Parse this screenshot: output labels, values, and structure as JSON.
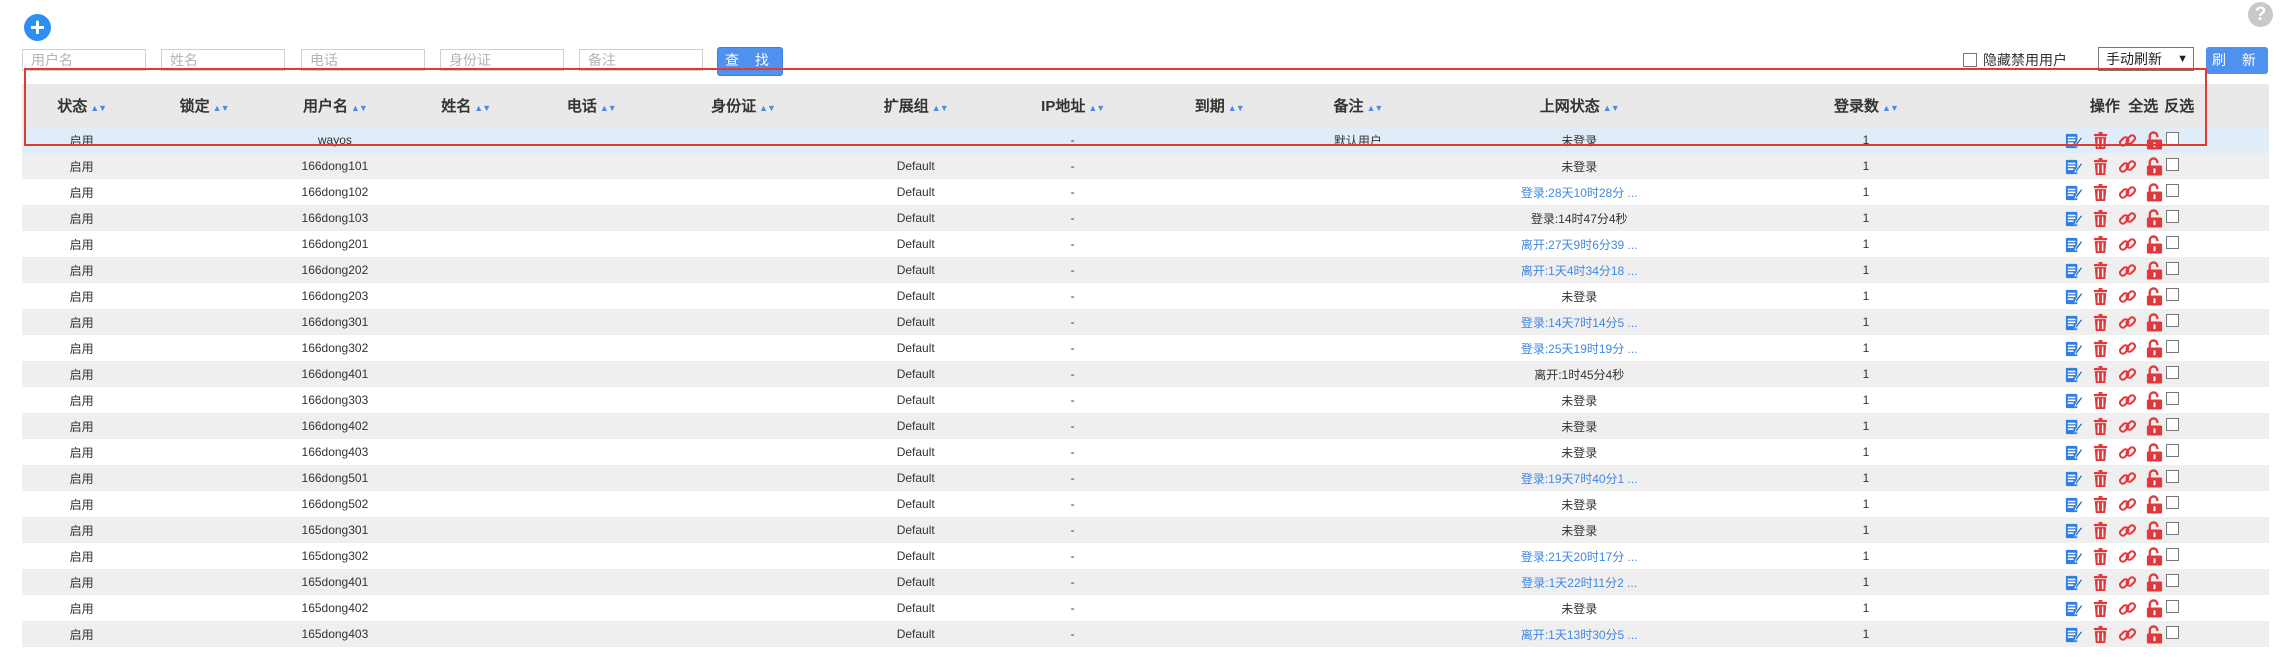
{
  "toolbar": {
    "add_symbol": "+",
    "help_symbol": "?",
    "filters": [
      {
        "placeholder": "用户名"
      },
      {
        "placeholder": "姓名"
      },
      {
        "placeholder": "电话"
      },
      {
        "placeholder": "身份证"
      },
      {
        "placeholder": "备注"
      }
    ],
    "search_label": "查 找",
    "hide_disabled_label": "隐藏禁用用户",
    "refresh_mode": "手动刷新",
    "refresh_label": "刷 新"
  },
  "table": {
    "headers": {
      "status": "状态",
      "lock": "锁定",
      "username": "用户名",
      "name": "姓名",
      "phone": "电话",
      "id_card": "身份证",
      "group": "扩展组",
      "ip": "IP地址",
      "expire": "到期",
      "note": "备注",
      "online": "上网状态",
      "logins": "登录数",
      "ops": "操作",
      "select_all": "全选",
      "invert": "反选"
    },
    "rows": [
      {
        "status": "启用",
        "lock": "",
        "username": "wayos",
        "name": "",
        "phone": "",
        "id_card": "",
        "group": "",
        "ip": "-",
        "expire": "",
        "note": "默认用户",
        "online": "未登录",
        "logins": "1",
        "online_link": false
      },
      {
        "status": "启用",
        "lock": "",
        "username": "166dong101",
        "name": "",
        "phone": "",
        "id_card": "",
        "group": "Default",
        "ip": "-",
        "expire": "",
        "note": "",
        "online": "未登录",
        "logins": "1",
        "online_link": false
      },
      {
        "status": "启用",
        "lock": "",
        "username": "166dong102",
        "name": "",
        "phone": "",
        "id_card": "",
        "group": "Default",
        "ip": "-",
        "expire": "",
        "note": "",
        "online": "登录:28天10时28分 ...",
        "logins": "1",
        "online_link": true
      },
      {
        "status": "启用",
        "lock": "",
        "username": "166dong103",
        "name": "",
        "phone": "",
        "id_card": "",
        "group": "Default",
        "ip": "-",
        "expire": "",
        "note": "",
        "online": "登录:14时47分4秒",
        "logins": "1",
        "online_link": false
      },
      {
        "status": "启用",
        "lock": "",
        "username": "166dong201",
        "name": "",
        "phone": "",
        "id_card": "",
        "group": "Default",
        "ip": "-",
        "expire": "",
        "note": "",
        "online": "离开:27天9时6分39 ...",
        "logins": "1",
        "online_link": true
      },
      {
        "status": "启用",
        "lock": "",
        "username": "166dong202",
        "name": "",
        "phone": "",
        "id_card": "",
        "group": "Default",
        "ip": "-",
        "expire": "",
        "note": "",
        "online": "离开:1天4时34分18 ...",
        "logins": "1",
        "online_link": true
      },
      {
        "status": "启用",
        "lock": "",
        "username": "166dong203",
        "name": "",
        "phone": "",
        "id_card": "",
        "group": "Default",
        "ip": "-",
        "expire": "",
        "note": "",
        "online": "未登录",
        "logins": "1",
        "online_link": false
      },
      {
        "status": "启用",
        "lock": "",
        "username": "166dong301",
        "name": "",
        "phone": "",
        "id_card": "",
        "group": "Default",
        "ip": "-",
        "expire": "",
        "note": "",
        "online": "登录:14天7时14分5 ...",
        "logins": "1",
        "online_link": true
      },
      {
        "status": "启用",
        "lock": "",
        "username": "166dong302",
        "name": "",
        "phone": "",
        "id_card": "",
        "group": "Default",
        "ip": "-",
        "expire": "",
        "note": "",
        "online": "登录:25天19时19分 ...",
        "logins": "1",
        "online_link": true
      },
      {
        "status": "启用",
        "lock": "",
        "username": "166dong401",
        "name": "",
        "phone": "",
        "id_card": "",
        "group": "Default",
        "ip": "-",
        "expire": "",
        "note": "",
        "online": "离开:1时45分4秒",
        "logins": "1",
        "online_link": false
      },
      {
        "status": "启用",
        "lock": "",
        "username": "166dong303",
        "name": "",
        "phone": "",
        "id_card": "",
        "group": "Default",
        "ip": "-",
        "expire": "",
        "note": "",
        "online": "未登录",
        "logins": "1",
        "online_link": false
      },
      {
        "status": "启用",
        "lock": "",
        "username": "166dong402",
        "name": "",
        "phone": "",
        "id_card": "",
        "group": "Default",
        "ip": "-",
        "expire": "",
        "note": "",
        "online": "未登录",
        "logins": "1",
        "online_link": false
      },
      {
        "status": "启用",
        "lock": "",
        "username": "166dong403",
        "name": "",
        "phone": "",
        "id_card": "",
        "group": "Default",
        "ip": "-",
        "expire": "",
        "note": "",
        "online": "未登录",
        "logins": "1",
        "online_link": false
      },
      {
        "status": "启用",
        "lock": "",
        "username": "166dong501",
        "name": "",
        "phone": "",
        "id_card": "",
        "group": "Default",
        "ip": "-",
        "expire": "",
        "note": "",
        "online": "登录:19天7时40分1 ...",
        "logins": "1",
        "online_link": true
      },
      {
        "status": "启用",
        "lock": "",
        "username": "166dong502",
        "name": "",
        "phone": "",
        "id_card": "",
        "group": "Default",
        "ip": "-",
        "expire": "",
        "note": "",
        "online": "未登录",
        "logins": "1",
        "online_link": false
      },
      {
        "status": "启用",
        "lock": "",
        "username": "165dong301",
        "name": "",
        "phone": "",
        "id_card": "",
        "group": "Default",
        "ip": "-",
        "expire": "",
        "note": "",
        "online": "未登录",
        "logins": "1",
        "online_link": false
      },
      {
        "status": "启用",
        "lock": "",
        "username": "165dong302",
        "name": "",
        "phone": "",
        "id_card": "",
        "group": "Default",
        "ip": "-",
        "expire": "",
        "note": "",
        "online": "登录:21天20时17分 ...",
        "logins": "1",
        "online_link": true
      },
      {
        "status": "启用",
        "lock": "",
        "username": "165dong401",
        "name": "",
        "phone": "",
        "id_card": "",
        "group": "Default",
        "ip": "-",
        "expire": "",
        "note": "",
        "online": "登录:1天22时11分2 ...",
        "logins": "1",
        "online_link": true
      },
      {
        "status": "启用",
        "lock": "",
        "username": "165dong402",
        "name": "",
        "phone": "",
        "id_card": "",
        "group": "Default",
        "ip": "-",
        "expire": "",
        "note": "",
        "online": "未登录",
        "logins": "1",
        "online_link": false
      },
      {
        "status": "启用",
        "lock": "",
        "username": "165dong403",
        "name": "",
        "phone": "",
        "id_card": "",
        "group": "Default",
        "ip": "-",
        "expire": "",
        "note": "",
        "online": "离开:1天13时30分5 ...",
        "logins": "1",
        "online_link": true
      }
    ]
  },
  "icons": [
    "edit-icon",
    "trash-icon",
    "link-icon",
    "unlock-icon"
  ],
  "colors": {
    "accent": "#4f91ee",
    "link": "#3f87e3",
    "action_red": "#e2383c",
    "edit_blue": "#2f7fe0",
    "highlight": "#e23a32"
  }
}
